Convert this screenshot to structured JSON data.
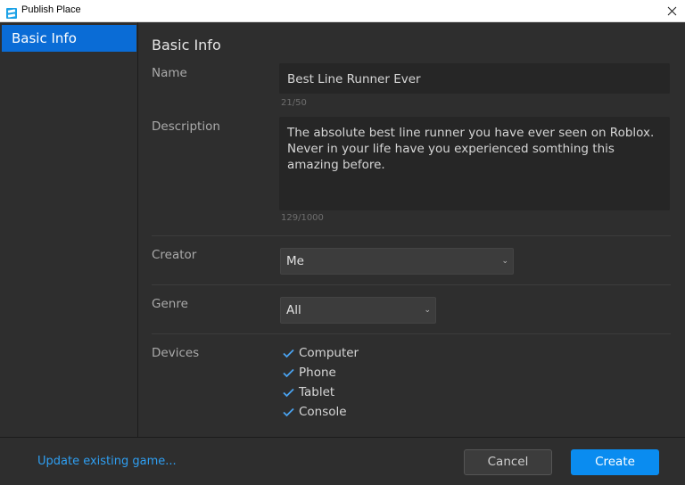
{
  "window": {
    "title": "Publish Place"
  },
  "sidebar": {
    "items": [
      {
        "label": "Basic Info",
        "selected": true
      }
    ]
  },
  "main": {
    "title": "Basic Info",
    "name": {
      "label": "Name",
      "value": "Best Line Runner Ever",
      "counter": "21/50"
    },
    "description": {
      "label": "Description",
      "value": "The absolute best line runner you have ever seen on Roblox. Never in your life have you experienced somthing this amazing before.",
      "counter": "129/1000"
    },
    "creator": {
      "label": "Creator",
      "selected": "Me"
    },
    "genre": {
      "label": "Genre",
      "selected": "All"
    },
    "devices": {
      "label": "Devices",
      "options": [
        {
          "label": "Computer",
          "checked": true
        },
        {
          "label": "Phone",
          "checked": true
        },
        {
          "label": "Tablet",
          "checked": true
        },
        {
          "label": "Console",
          "checked": true
        }
      ]
    }
  },
  "footer": {
    "update_link": "Update existing game...",
    "cancel_label": "Cancel",
    "create_label": "Create"
  },
  "colors": {
    "accent": "#0a6cd6",
    "primary_button": "#0a8cf0",
    "link": "#2f9ff2",
    "background": "#2e2e2e"
  },
  "icons": {
    "app": "roblox-studio-icon",
    "close": "close-icon",
    "check": "checkmark-icon",
    "dropdown": "chevron-down-icon"
  }
}
